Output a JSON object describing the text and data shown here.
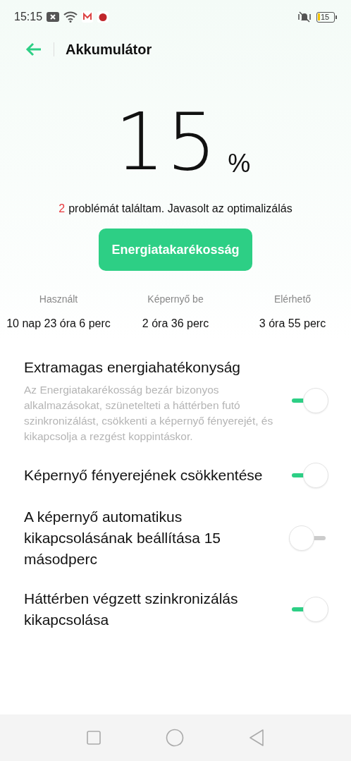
{
  "status_bar": {
    "time": "15:15",
    "battery": "15"
  },
  "header": {
    "title": "Akkumulátor"
  },
  "battery": {
    "percent": "15",
    "unit": "%"
  },
  "problems": {
    "count": "2",
    "text": "problémát találtam. Javasolt az optimalizálás"
  },
  "action_button": "Energiatakarékosság",
  "stats": [
    {
      "label": "Használt",
      "value": "10 nap 23 óra 6 perc"
    },
    {
      "label": "Képernyő be",
      "value": "2 óra 36 perc"
    },
    {
      "label": "Elérhető",
      "value": "3 óra 55 perc"
    }
  ],
  "settings": [
    {
      "title": "Extramagas energiahatékonyság",
      "description": "Az Energiatakarékosság bezár bizonyos alkalmazásokat, szünetelteti a háttérben futó szinkronizálást, csökkenti a képernyő fényerejét, és kikapcsolja a rezgést koppintáskor.",
      "on": true
    },
    {
      "title": "Képernyő fényerejének csökkentése",
      "on": true
    },
    {
      "title": "A képernyő automatikus kikapcsolásának beállítása 15 másodperc",
      "on": false
    },
    {
      "title": "Háttérben végzett szinkronizálás kikapcsolása",
      "on": true
    }
  ]
}
